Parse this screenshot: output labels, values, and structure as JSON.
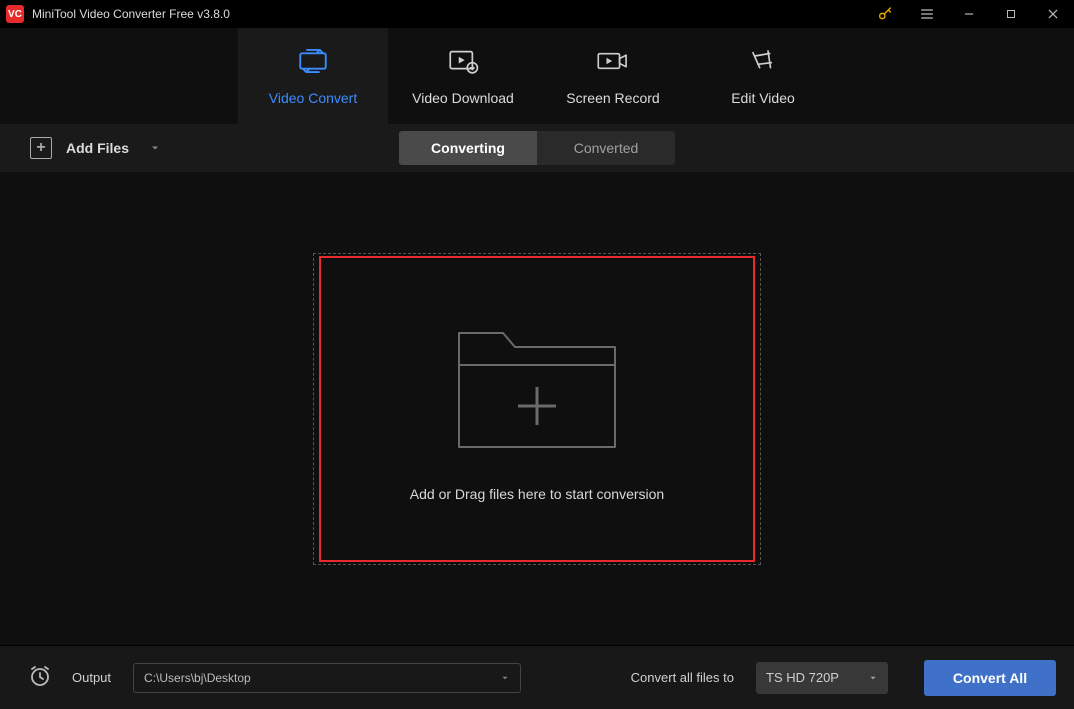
{
  "app": {
    "title": "MiniTool Video Converter Free v3.8.0",
    "logo_text": "VC"
  },
  "tabs": {
    "convert": "Video Convert",
    "download": "Video Download",
    "record": "Screen Record",
    "edit": "Edit Video"
  },
  "toolbar": {
    "add_files": "Add Files"
  },
  "toggle": {
    "converting": "Converting",
    "converted": "Converted"
  },
  "drop": {
    "hint": "Add or Drag files here to start conversion"
  },
  "footer": {
    "output_label": "Output",
    "output_path": "C:\\Users\\bj\\Desktop",
    "convert_all_label": "Convert all files to",
    "preset": "TS HD 720P",
    "convert_all_btn": "Convert All"
  }
}
